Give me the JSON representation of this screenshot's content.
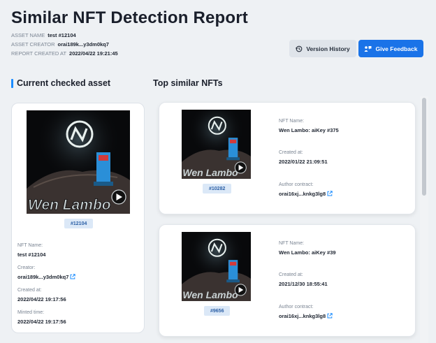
{
  "header": {
    "title": "Similar NFT Detection Report",
    "asset_name_label": "ASSET NAME",
    "asset_name": "test #12104",
    "asset_creator_label": "ASSET CREATOR",
    "asset_creator": "orai189k...y3dm0kq7",
    "report_created_label": "REPORT CREATED AT",
    "report_created": "2022/04/22 19:21:45"
  },
  "actions": {
    "version_history": "Version History",
    "give_feedback": "Give Feedback"
  },
  "sections": {
    "current": "Current checked asset",
    "similar": "Top similar NFTs"
  },
  "image_text": "Wen Lambo",
  "current_asset": {
    "token_id": "#12104",
    "nft_name_label": "NFT Name:",
    "nft_name": "test #12104",
    "creator_label": "Creator:",
    "creator": "orai189k...y3dm0kq7",
    "created_label": "Created at:",
    "created": "2022/04/22 19:17:56",
    "minted_label": "Minted time:",
    "minted": "2022/04/22 19:17:56"
  },
  "similar_nfts": [
    {
      "token_id": "#10282",
      "nft_name_label": "NFT Name:",
      "nft_name": "Wen Lambo: aiKey #375",
      "created_label": "Created at:",
      "created": "2022/01/22 21:09:51",
      "author_label": "Author contract:",
      "author": "orai16xj...knkg3lg8"
    },
    {
      "token_id": "#9656",
      "nft_name_label": "NFT Name:",
      "nft_name": "Wen Lambo: aiKey #39",
      "created_label": "Created at:",
      "created": "2021/12/30 18:55:41",
      "author_label": "Author contract:",
      "author": "orai16xj...knkg3lg8"
    }
  ],
  "colors": {
    "accent": "#1a73e8",
    "badge_bg": "#dbe8f7",
    "badge_text": "#2b5fa6",
    "page_bg": "#eef1f4"
  },
  "icons": {
    "history": "history-icon",
    "feedback": "feedback-icon",
    "external_link": "external-link-icon",
    "play": "play-icon"
  }
}
